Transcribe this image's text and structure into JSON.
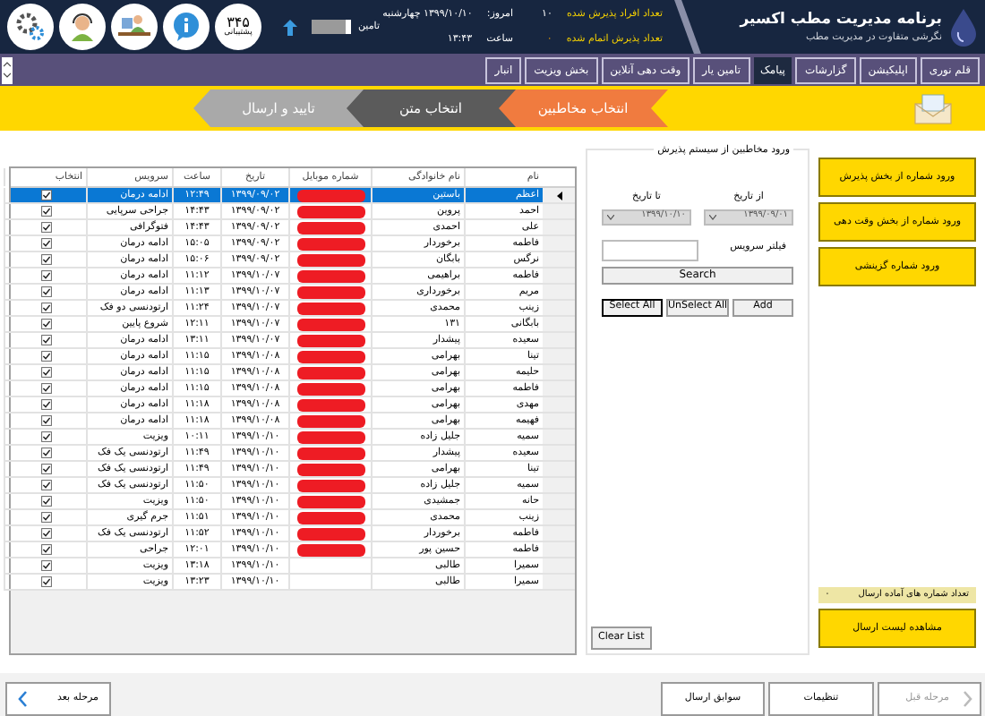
{
  "app": {
    "title": "برنامه مدیریت مطب اکسیر",
    "subtitle": "نگرشی متفاوت در مدیریت مطب"
  },
  "stats": [
    {
      "label": "تعداد افراد پذیرش شده",
      "value": "۱۰"
    },
    {
      "label": "امروز:",
      "value": "۱۳۹۹/۱۰/۱۰   چهارشنبه"
    },
    {
      "label": "تعداد پذیرش اتمام شده",
      "value": "۰"
    },
    {
      "label": "ساعت",
      "value": "۱۳:۴۳"
    }
  ],
  "tamin": {
    "label": "تامین",
    "on": false
  },
  "support": {
    "number": "۳۴۵",
    "label": "پشتیبانی"
  },
  "nav_tabs": [
    {
      "label": "قلم نوری",
      "selected": false
    },
    {
      "label": "اپلیکیشن",
      "selected": false
    },
    {
      "label": "گزارشات",
      "selected": false
    },
    {
      "label": "پیامک",
      "selected": true
    },
    {
      "label": "تامین یار",
      "selected": false
    },
    {
      "label": "وقت دهی آنلاین",
      "selected": false
    },
    {
      "label": "بخش ویزیت",
      "selected": false
    },
    {
      "label": "انبار",
      "selected": false
    }
  ],
  "steps": [
    {
      "label": "انتخاب مخاطبین",
      "color": "#f07b3f"
    },
    {
      "label": "انتخاب متن",
      "color": "#5b5b5b"
    },
    {
      "label": "تایید و ارسال",
      "color": "#a9a9a9"
    }
  ],
  "table": {
    "columns": [
      "نام",
      "نام خانوادگی",
      "شماره موبایل",
      "تاریخ",
      "ساعت",
      "سرویس",
      "انتخاب"
    ],
    "rows": [
      {
        "name": "اعظم",
        "family": "باستین",
        "redacted": true,
        "date": "۱۳۹۹/۰۹/۰۲",
        "time": "۱۲:۴۹",
        "service": "ادامه درمان",
        "checked": true,
        "selected": true
      },
      {
        "name": "احمد",
        "family": "پروین",
        "redacted": true,
        "date": "۱۳۹۹/۰۹/۰۲",
        "time": "۱۴:۴۳",
        "service": "جراحی سرپایی",
        "checked": true,
        "selected": false
      },
      {
        "name": "علی",
        "family": "احمدی",
        "redacted": true,
        "date": "۱۳۹۹/۰۹/۰۲",
        "time": "۱۴:۴۳",
        "service": "فتوگرافی",
        "checked": true,
        "selected": false
      },
      {
        "name": "فاطمه",
        "family": "برخوردار",
        "redacted": true,
        "date": "۱۳۹۹/۰۹/۰۲",
        "time": "۱۵:۰۵",
        "service": "ادامه درمان",
        "checked": true,
        "selected": false
      },
      {
        "name": "نرگس",
        "family": "بابگان",
        "redacted": true,
        "date": "۱۳۹۹/۰۹/۰۲",
        "time": "۱۵:۰۶",
        "service": "ادامه درمان",
        "checked": true,
        "selected": false
      },
      {
        "name": "فاطمه",
        "family": "براهیمی",
        "redacted": true,
        "date": "۱۳۹۹/۱۰/۰۷",
        "time": "۱۱:۱۲",
        "service": "ادامه درمان",
        "checked": true,
        "selected": false
      },
      {
        "name": "مریم",
        "family": "برخورداری",
        "redacted": true,
        "date": "۱۳۹۹/۱۰/۰۷",
        "time": "۱۱:۱۳",
        "service": "ادامه درمان",
        "checked": true,
        "selected": false
      },
      {
        "name": "زینب",
        "family": "محمدی",
        "redacted": true,
        "date": "۱۳۹۹/۱۰/۰۷",
        "time": "۱۱:۲۴",
        "service": "ارتودنسی دو فک",
        "checked": true,
        "selected": false
      },
      {
        "name": "بابگانی",
        "family": "۱۳۱",
        "redacted": true,
        "date": "۱۳۹۹/۱۰/۰۷",
        "time": "۱۲:۱۱",
        "service": "شروع پایین",
        "checked": true,
        "selected": false
      },
      {
        "name": "سعیده",
        "family": "پیشدار",
        "redacted": true,
        "date": "۱۳۹۹/۱۰/۰۷",
        "time": "۱۳:۱۱",
        "service": "ادامه درمان",
        "checked": true,
        "selected": false
      },
      {
        "name": "تینا",
        "family": "بهرامی",
        "redacted": true,
        "date": "۱۳۹۹/۱۰/۰۸",
        "time": "۱۱:۱۵",
        "service": "ادامه درمان",
        "checked": true,
        "selected": false
      },
      {
        "name": "حلیمه",
        "family": "بهرامی",
        "redacted": true,
        "date": "۱۳۹۹/۱۰/۰۸",
        "time": "۱۱:۱۵",
        "service": "ادامه درمان",
        "checked": true,
        "selected": false
      },
      {
        "name": "فاطمه",
        "family": "بهرامی",
        "redacted": true,
        "date": "۱۳۹۹/۱۰/۰۸",
        "time": "۱۱:۱۵",
        "service": "ادامه درمان",
        "checked": true,
        "selected": false
      },
      {
        "name": "مهدی",
        "family": "بهرامی",
        "redacted": true,
        "date": "۱۳۹۹/۱۰/۰۸",
        "time": "۱۱:۱۸",
        "service": "ادامه درمان",
        "checked": true,
        "selected": false
      },
      {
        "name": "فهیمه",
        "family": "بهرامی",
        "redacted": true,
        "date": "۱۳۹۹/۱۰/۰۸",
        "time": "۱۱:۱۸",
        "service": "ادامه درمان",
        "checked": true,
        "selected": false
      },
      {
        "name": "سمیه",
        "family": "جلیل زاده",
        "redacted": true,
        "date": "۱۳۹۹/۱۰/۱۰",
        "time": "۱۰:۱۱",
        "service": "ویزیت",
        "checked": true,
        "selected": false
      },
      {
        "name": "سعیده",
        "family": "پیشدار",
        "redacted": true,
        "date": "۱۳۹۹/۱۰/۱۰",
        "time": "۱۱:۴۹",
        "service": "ارتودنسی یک فک",
        "checked": true,
        "selected": false
      },
      {
        "name": "تینا",
        "family": "بهرامی",
        "redacted": true,
        "date": "۱۳۹۹/۱۰/۱۰",
        "time": "۱۱:۴۹",
        "service": "ارتودنسی یک فک",
        "checked": true,
        "selected": false
      },
      {
        "name": "سمیه",
        "family": "جلیل زاده",
        "redacted": true,
        "date": "۱۳۹۹/۱۰/۱۰",
        "time": "۱۱:۵۰",
        "service": "ارتودنسی یک فک",
        "checked": true,
        "selected": false
      },
      {
        "name": "حانه",
        "family": "جمشیدی",
        "redacted": true,
        "date": "۱۳۹۹/۱۰/۱۰",
        "time": "۱۱:۵۰",
        "service": "ویزیت",
        "checked": true,
        "selected": false
      },
      {
        "name": "زینب",
        "family": "محمدی",
        "redacted": true,
        "date": "۱۳۹۹/۱۰/۱۰",
        "time": "۱۱:۵۱",
        "service": "جرم گیری",
        "checked": true,
        "selected": false
      },
      {
        "name": "فاطمه",
        "family": "برخوردار",
        "redacted": true,
        "date": "۱۳۹۹/۱۰/۱۰",
        "time": "۱۱:۵۲",
        "service": "ارتودنسی یک فک",
        "checked": true,
        "selected": false
      },
      {
        "name": "فاطمه",
        "family": "حسین پور",
        "redacted": true,
        "date": "۱۳۹۹/۱۰/۱۰",
        "time": "۱۲:۰۱",
        "service": "جراحی",
        "checked": true,
        "selected": false
      },
      {
        "name": "سمیرا",
        "family": "طالبی",
        "redacted": false,
        "date": "۱۳۹۹/۱۰/۱۰",
        "time": "۱۳:۱۸",
        "service": "ویزیت",
        "checked": true,
        "selected": false
      },
      {
        "name": "سمیرا",
        "family": "طالبی",
        "redacted": false,
        "date": "۱۳۹۹/۱۰/۱۰",
        "time": "۱۳:۲۳",
        "service": "ویزیت",
        "checked": true,
        "selected": false
      }
    ]
  },
  "filter": {
    "title": "ورود مخاطبین از سیستم پذیرش",
    "from_label": "از تاریخ",
    "from_value": "۱۳۹۹/۰۹/۰۱",
    "to_label": "تا تاریخ",
    "to_value": "۱۳۹۹/۱۰/۱۰",
    "service_label": "فیلتر سرویس",
    "search_button": "Search",
    "buttons": [
      {
        "label": "Add",
        "focused": false
      },
      {
        "label": "UnSelect All",
        "focused": false
      },
      {
        "label": "Select All",
        "focused": true
      }
    ],
    "clear_button": "Clear List"
  },
  "side": {
    "import_buttons": [
      "ورود شماره از بخش پذیرش",
      "ورود شماره از بخش وقت دهی",
      "ورود شماره گزینشی"
    ],
    "ready_count": {
      "label": "تعداد شماره های آماده ارسال",
      "value": "۰"
    },
    "view_list_button": "مشاهده لیست ارسال"
  },
  "footer": {
    "prev": {
      "label": "مرحله قبل",
      "disabled": true
    },
    "settings": "تنظیمات",
    "history": "سوابق ارسال",
    "next": {
      "label": "مرحله بعد",
      "disabled": false
    }
  }
}
